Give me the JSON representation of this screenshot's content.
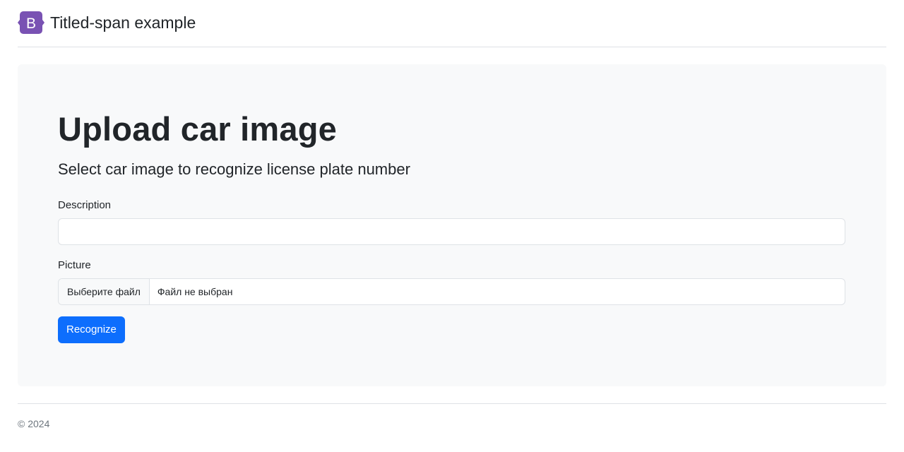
{
  "header": {
    "logo_letter": "B",
    "title": "Titled-span example"
  },
  "hero": {
    "title": "Upload car image",
    "lead": "Select car image to recognize license plate number"
  },
  "form": {
    "description": {
      "label": "Description",
      "value": "",
      "placeholder": ""
    },
    "picture": {
      "label": "Picture",
      "button_label": "Выберите файл",
      "status": "Файл не выбран"
    },
    "submit_label": "Recognize"
  },
  "footer": {
    "copyright": "© 2024"
  },
  "colors": {
    "brand": "#7952b3",
    "primary": "#0d6efd",
    "hero_bg": "#f8f9fa",
    "border": "#dee2e6",
    "muted": "#6c757d"
  },
  "icons": {
    "logo": "bootstrap-logo-icon"
  }
}
